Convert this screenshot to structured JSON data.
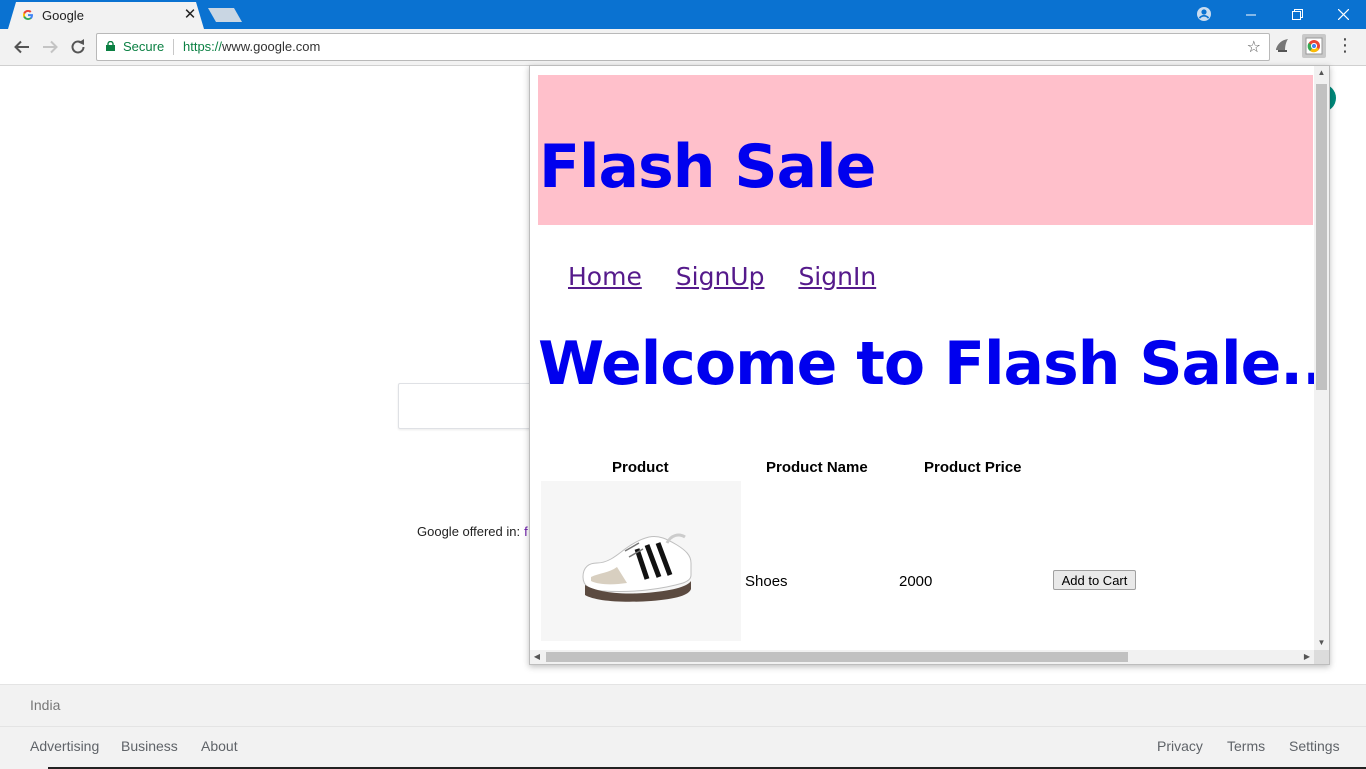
{
  "browser": {
    "tab_title": "Google",
    "tab_close": "✕",
    "omnibox": {
      "secure_label": "Secure",
      "url_protocol": "https://",
      "url_rest": "www.google.com"
    }
  },
  "google": {
    "offered_in_label": "Google offered in:",
    "offered_lang_partial": "f",
    "footer": {
      "country": "India",
      "left_links": [
        "Advertising",
        "Business",
        "About"
      ],
      "right_links": [
        "Privacy",
        "Terms",
        "Settings"
      ]
    }
  },
  "popup": {
    "banner_title": "Flash Sale",
    "nav": [
      "Home",
      "SignUp",
      "SignIn"
    ],
    "welcome": "Welcome to Flash Sale...",
    "table": {
      "headers": [
        "Product",
        "Product Name",
        "Product Price"
      ],
      "rows": [
        {
          "name": "Shoes",
          "price": "2000",
          "action": "Add to Cart"
        }
      ]
    }
  },
  "colors": {
    "titlebar": "#0a72d1",
    "banner_bg": "#ffc0cb",
    "heading_blue": "#0000ee",
    "visited_link": "#551a8b",
    "secure_green": "#0b8043"
  }
}
